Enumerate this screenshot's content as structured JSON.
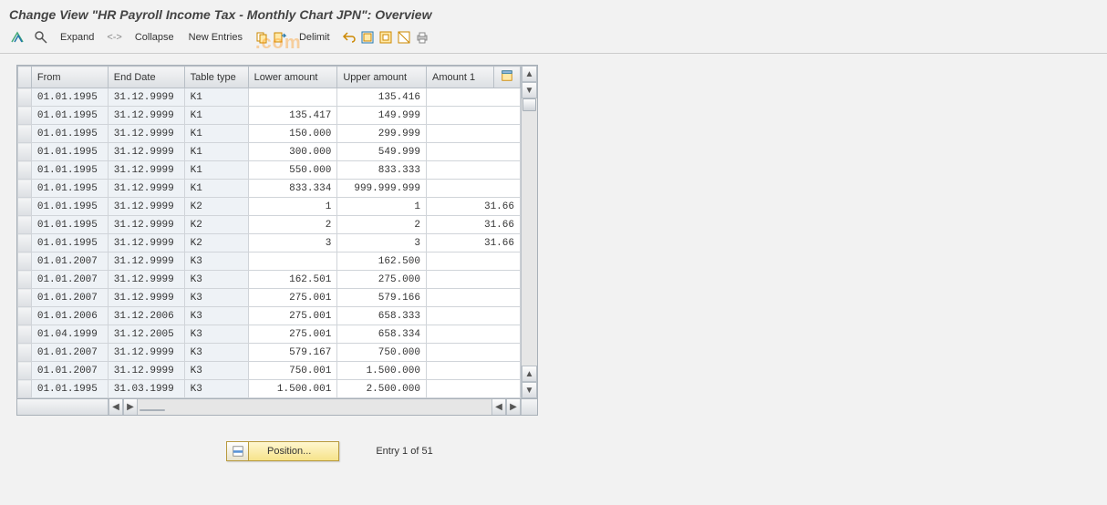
{
  "title": "Change View \"HR Payroll Income Tax - Monthly Chart JPN\": Overview",
  "toolbar": {
    "expand": "Expand",
    "sep": "<->",
    "collapse": "Collapse",
    "new_entries": "New Entries",
    "delimit": "Delimit"
  },
  "columns": {
    "from": "From",
    "end": "End Date",
    "type": "Table type",
    "lower": "Lower amount",
    "upper": "Upper amount",
    "amt1": "Amount 1"
  },
  "rows": [
    {
      "from": "01.01.1995",
      "end": "31.12.9999",
      "type": "K1",
      "lower": "",
      "upper": "135.416",
      "amt1": ""
    },
    {
      "from": "01.01.1995",
      "end": "31.12.9999",
      "type": "K1",
      "lower": "135.417",
      "upper": "149.999",
      "amt1": ""
    },
    {
      "from": "01.01.1995",
      "end": "31.12.9999",
      "type": "K1",
      "lower": "150.000",
      "upper": "299.999",
      "amt1": ""
    },
    {
      "from": "01.01.1995",
      "end": "31.12.9999",
      "type": "K1",
      "lower": "300.000",
      "upper": "549.999",
      "amt1": ""
    },
    {
      "from": "01.01.1995",
      "end": "31.12.9999",
      "type": "K1",
      "lower": "550.000",
      "upper": "833.333",
      "amt1": ""
    },
    {
      "from": "01.01.1995",
      "end": "31.12.9999",
      "type": "K1",
      "lower": "833.334",
      "upper": "999.999.999",
      "amt1": ""
    },
    {
      "from": "01.01.1995",
      "end": "31.12.9999",
      "type": "K2",
      "lower": "1",
      "upper": "1",
      "amt1": "31.66"
    },
    {
      "from": "01.01.1995",
      "end": "31.12.9999",
      "type": "K2",
      "lower": "2",
      "upper": "2",
      "amt1": "31.66"
    },
    {
      "from": "01.01.1995",
      "end": "31.12.9999",
      "type": "K2",
      "lower": "3",
      "upper": "3",
      "amt1": "31.66"
    },
    {
      "from": "01.01.2007",
      "end": "31.12.9999",
      "type": "K3",
      "lower": "",
      "upper": "162.500",
      "amt1": ""
    },
    {
      "from": "01.01.2007",
      "end": "31.12.9999",
      "type": "K3",
      "lower": "162.501",
      "upper": "275.000",
      "amt1": ""
    },
    {
      "from": "01.01.2007",
      "end": "31.12.9999",
      "type": "K3",
      "lower": "275.001",
      "upper": "579.166",
      "amt1": ""
    },
    {
      "from": "01.01.2006",
      "end": "31.12.2006",
      "type": "K3",
      "lower": "275.001",
      "upper": "658.333",
      "amt1": ""
    },
    {
      "from": "01.04.1999",
      "end": "31.12.2005",
      "type": "K3",
      "lower": "275.001",
      "upper": "658.334",
      "amt1": ""
    },
    {
      "from": "01.01.2007",
      "end": "31.12.9999",
      "type": "K3",
      "lower": "579.167",
      "upper": "750.000",
      "amt1": ""
    },
    {
      "from": "01.01.2007",
      "end": "31.12.9999",
      "type": "K3",
      "lower": "750.001",
      "upper": "1.500.000",
      "amt1": ""
    },
    {
      "from": "01.01.1995",
      "end": "31.03.1999",
      "type": "K3",
      "lower": "1.500.001",
      "upper": "2.500.000",
      "amt1": ""
    }
  ],
  "footer": {
    "position_label": "Position...",
    "entry_status": "Entry 1 of 51"
  },
  "watermark": ".com"
}
